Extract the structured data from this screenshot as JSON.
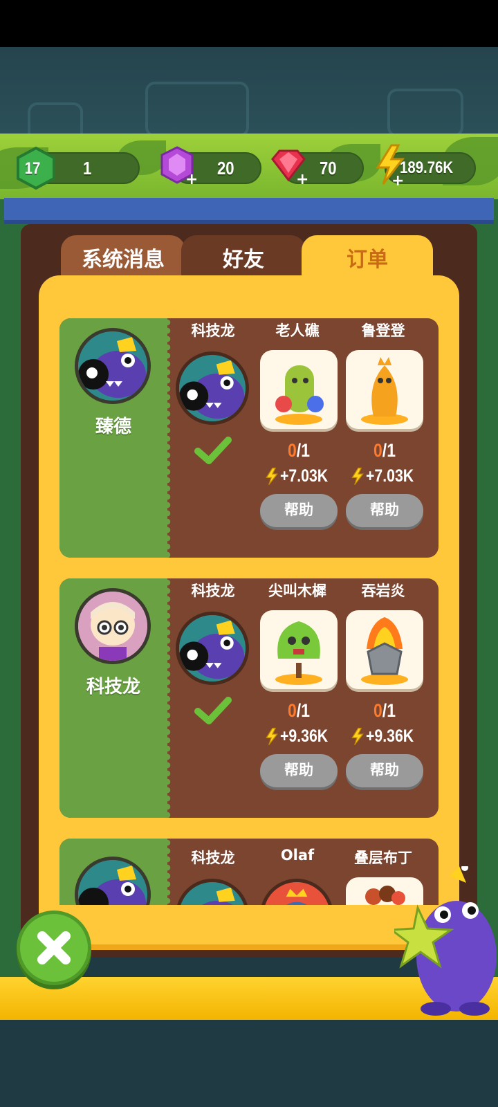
{
  "resources": {
    "level": "17",
    "xp": "1",
    "purple_gems": "20",
    "red_gems": "70",
    "energy": "189.76K",
    "icons": [
      "level-hex-icon",
      "purple-gem-icon",
      "red-gem-icon",
      "lightning-icon"
    ]
  },
  "tabs": [
    {
      "label": "系统消息",
      "active": false
    },
    {
      "label": "好友",
      "active": false
    },
    {
      "label": "订单",
      "active": true
    }
  ],
  "orders": [
    {
      "owner": "臻德",
      "slots": [
        {
          "name": "科技龙",
          "type": "avatar",
          "done": true
        },
        {
          "name": "老人礁",
          "type": "item",
          "progress_current": "0",
          "progress_total": "/1",
          "reward": "+7.03K",
          "help": "帮助"
        },
        {
          "name": "鲁登登",
          "type": "item",
          "progress_current": "0",
          "progress_total": "/1",
          "reward": "+7.03K",
          "help": "帮助"
        }
      ]
    },
    {
      "owner": "科技龙",
      "slots": [
        {
          "name": "科技龙",
          "type": "avatar",
          "done": true
        },
        {
          "name": "尖叫木樨",
          "type": "item",
          "progress_current": "0",
          "progress_total": "/1",
          "reward": "+9.36K",
          "help": "帮助"
        },
        {
          "name": "吞岩炎",
          "type": "item",
          "progress_current": "0",
          "progress_total": "/1",
          "reward": "+9.36K",
          "help": "帮助"
        }
      ]
    },
    {
      "owner": "",
      "slots": [
        {
          "name": "科技龙",
          "type": "avatar"
        },
        {
          "name": "Olaf",
          "type": "avatar"
        },
        {
          "name": "叠层布丁",
          "type": "item"
        }
      ]
    }
  ],
  "colors": {
    "accent_green": "#6aa142",
    "panel_yellow": "#ffc83a",
    "card_brown": "#7b4530",
    "progress_orange": "#ff7a2a"
  }
}
